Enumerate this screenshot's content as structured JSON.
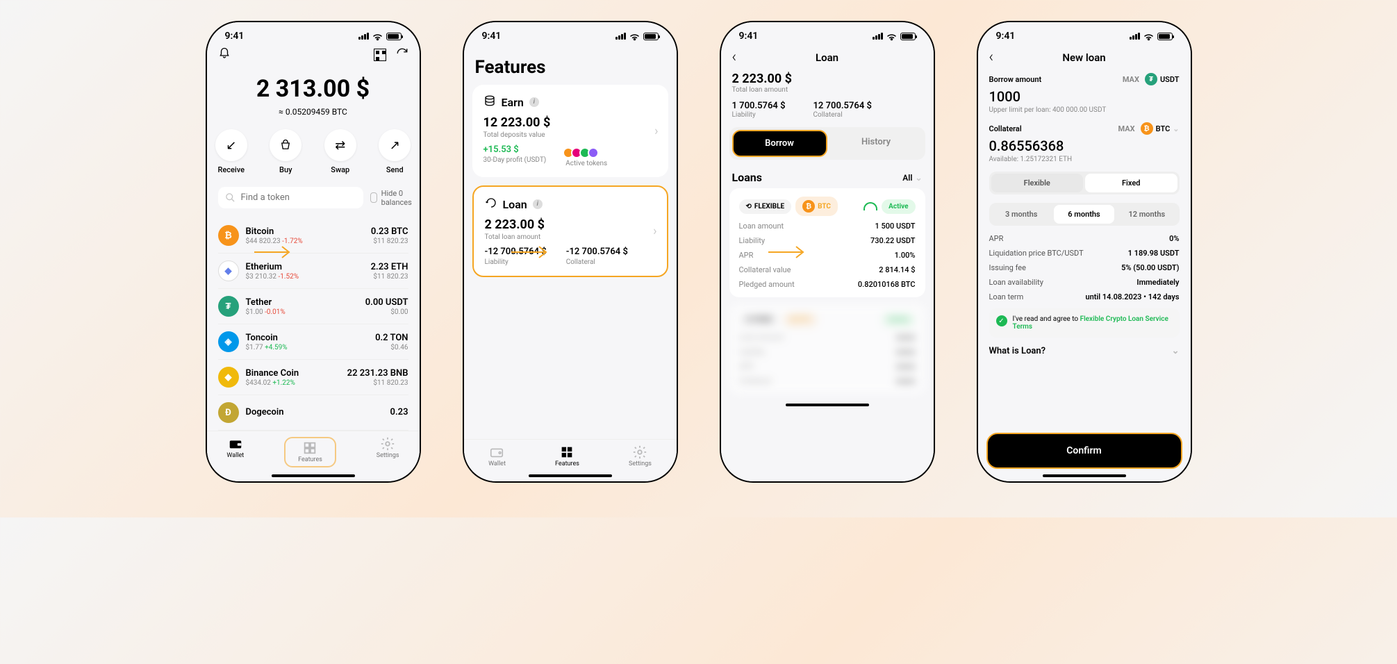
{
  "status_time": "9:41",
  "screen1": {
    "balance": "2 313.00 $",
    "balance_sub": "≈ 0.05209459 BTC",
    "actions": {
      "receive": "Receive",
      "buy": "Buy",
      "swap": "Swap",
      "send": "Send"
    },
    "search_placeholder": "Find a token",
    "hide_zero": "Hide 0 balances",
    "tokens": [
      {
        "name": "Bitcoin",
        "price": "$44 820.23",
        "pct": "-1.72%",
        "pct_cls": "pct-neg",
        "amt": "0.23 BTC",
        "fiat": "$11 820.23",
        "sym": "₿",
        "bg": "circ-orange"
      },
      {
        "name": "Etherium",
        "price": "$3 210.32",
        "pct": "-1.52%",
        "pct_cls": "pct-neg",
        "amt": "2.23 ETH",
        "fiat": "$11 820.23",
        "sym": "◆",
        "bg": "circ-eth"
      },
      {
        "name": "Tether",
        "price": "$1.00",
        "pct": "-0.01%",
        "pct_cls": "pct-neg",
        "amt": "0.00 USDT",
        "fiat": "$0.00",
        "sym": "₮",
        "bg": "circ-usdt"
      },
      {
        "name": "Toncoin",
        "price": "$1.77",
        "pct": "+4.59%",
        "pct_cls": "pct-pos",
        "amt": "0.2 TON",
        "fiat": "$0.46",
        "sym": "◈",
        "bg": "circ-ton"
      },
      {
        "name": "Binance Coin",
        "price": "$434.02",
        "pct": "+1.22%",
        "pct_cls": "pct-pos",
        "amt": "22 231.23 BNB",
        "fiat": "$11 820.23",
        "sym": "◆",
        "bg": "circ-bnb"
      },
      {
        "name": "Dogecoin",
        "price": "",
        "pct": "",
        "pct_cls": "",
        "amt": "0.23",
        "fiat": "",
        "sym": "Ð",
        "bg": "circ-doge"
      }
    ],
    "nav": {
      "wallet": "Wallet",
      "features": "Features",
      "settings": "Settings"
    }
  },
  "screen2": {
    "title": "Features",
    "earn": {
      "label": "Earn",
      "value": "12 223.00 $",
      "value_sub": "Total deposits value",
      "profit": "+15.53 $",
      "profit_sub": "30-Day profit (USDT)",
      "active_label": "Active tokens"
    },
    "loan": {
      "label": "Loan",
      "value": "2 223.00 $",
      "value_sub": "Total loan amount",
      "liability": "-12 700.5764 $",
      "liability_sub": "Liability",
      "collateral": "-12 700.5764 $",
      "collateral_sub": "Collateral"
    }
  },
  "screen3": {
    "title": "Loan",
    "total": "2 223.00 $",
    "total_sub": "Total loan amount",
    "liability": "1 700.5764 $",
    "liability_sub": "Liability",
    "collateral": "12 700.5764 $",
    "collateral_sub": "Collateral",
    "tab_borrow": "Borrow",
    "tab_history": "History",
    "loans_title": "Loans",
    "filter": "All",
    "loan1": {
      "type": "FLEXIBLE",
      "coin": "BTC",
      "status": "Active",
      "rows": [
        {
          "k": "Loan amount",
          "v": "1 500 USDT"
        },
        {
          "k": "Liability",
          "v": "730.22 USDT"
        },
        {
          "k": "APR",
          "v": "1.00%"
        },
        {
          "k": "Collateral value",
          "v": "2 814.14 $"
        },
        {
          "k": "Pledged amount",
          "v": "0.82010168 BTC"
        }
      ]
    }
  },
  "screen4": {
    "title": "New loan",
    "borrow_label": "Borrow amount",
    "borrow_value": "1000",
    "borrow_curr": "USDT",
    "borrow_hint": "Upper limit per loan: 400 000.00 USDT",
    "collat_label": "Collateral",
    "collat_value": "0.86556368",
    "collat_curr": "BTC",
    "collat_hint": "Available: 1.25172321 ETH",
    "max": "MAX",
    "mode_flex": "Flexible",
    "mode_fixed": "Fixed",
    "terms": {
      "t3": "3 months",
      "t6": "6 months",
      "t12": "12 months"
    },
    "rows": [
      {
        "k": "APR",
        "v": "0%"
      },
      {
        "k": "Liquidation price BTC/USDT",
        "v": "1 189.98 USDT"
      },
      {
        "k": "Issuing fee",
        "v": "5% (50.00 USDT)"
      },
      {
        "k": "Loan availability",
        "v": "Immediately"
      },
      {
        "k": "Loan term",
        "v": "until 14.08.2023 • 142 days"
      }
    ],
    "agree_prefix": "I've read and agree to ",
    "agree_link": "Flexible Crypto Loan Service Terms",
    "what_is": "What is Loan?",
    "confirm": "Confirm"
  }
}
